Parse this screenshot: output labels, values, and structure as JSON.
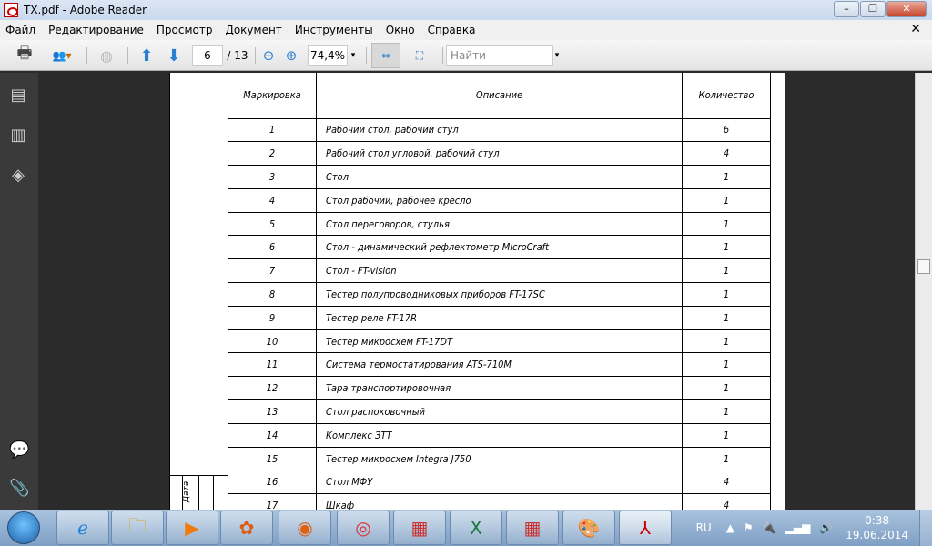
{
  "window": {
    "title": "TX.pdf - Adobe Reader"
  },
  "menu": [
    "Файл",
    "Редактирование",
    "Просмотр",
    "Документ",
    "Инструменты",
    "Окно",
    "Справка"
  ],
  "toolbar": {
    "page_current": "6",
    "page_total": "/ 13",
    "zoom": "74,4%",
    "search_placeholder": "Найти"
  },
  "table": {
    "headers": [
      "Маркировка",
      "Описание",
      "Количество"
    ],
    "rows": [
      [
        "1",
        "Рабочий стол, рабочий стул",
        "6"
      ],
      [
        "2",
        "Рабочий стол угловой, рабочий стул",
        "4"
      ],
      [
        "3",
        "Стол",
        "1"
      ],
      [
        "4",
        "Стол рабочий, рабочее кресло",
        "1"
      ],
      [
        "5",
        "Стол переговоров, стулья",
        "1"
      ],
      [
        "6",
        "Стол  - динамический рефлектометр  MicroCraft",
        "1"
      ],
      [
        "7",
        "Стол  - FT-vision",
        "1"
      ],
      [
        "8",
        "Тестер полупроводниковых приборов  FT-17SC",
        "1"
      ],
      [
        "9",
        "Тестер реле  FT-17R",
        "1"
      ],
      [
        "10",
        "Тестер микросхем  FT-17DT",
        "1"
      ],
      [
        "11",
        "Система термостатирования  ATS-710M",
        "1"
      ],
      [
        "12",
        "Тара транспортировочная",
        "1"
      ],
      [
        "13",
        "Стол распоковочный",
        "1"
      ],
      [
        "14",
        "Комплекс ЗТТ",
        "1"
      ],
      [
        "15",
        "Тестер микросхем  Integra J750",
        "1"
      ],
      [
        "16",
        "Стол МФУ",
        "4"
      ],
      [
        "17",
        "Шкаф",
        "4"
      ]
    ]
  },
  "stamp": {
    "date_label": "Дата"
  },
  "taskbar": {
    "tray_lang": "RU",
    "time": "0:38",
    "date": "19.06.2014"
  }
}
